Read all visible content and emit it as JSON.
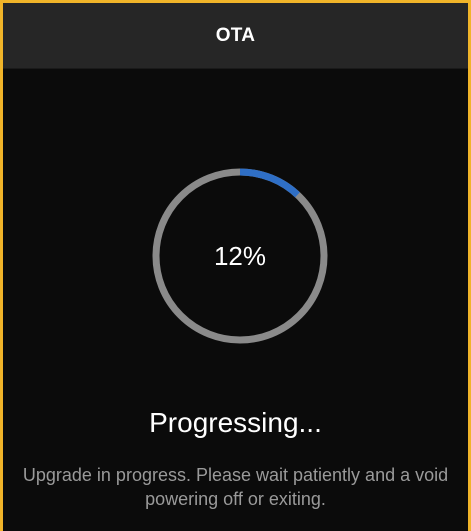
{
  "header": {
    "title": "OTA"
  },
  "progress": {
    "percent_label": "12%",
    "fraction": 0.12
  },
  "status": {
    "label": "Progressing..."
  },
  "message": {
    "text": "Upgrade in progress. Please wait patiently and a void powering off or exiting."
  },
  "colors": {
    "frame_border": "#f0b429",
    "background": "#0b0b0b",
    "header_bg": "#262626",
    "ring_track": "#8a8a8a",
    "ring_progress": "#2f6fc6",
    "text_primary": "#ffffff",
    "text_secondary": "#9a9a9a"
  }
}
